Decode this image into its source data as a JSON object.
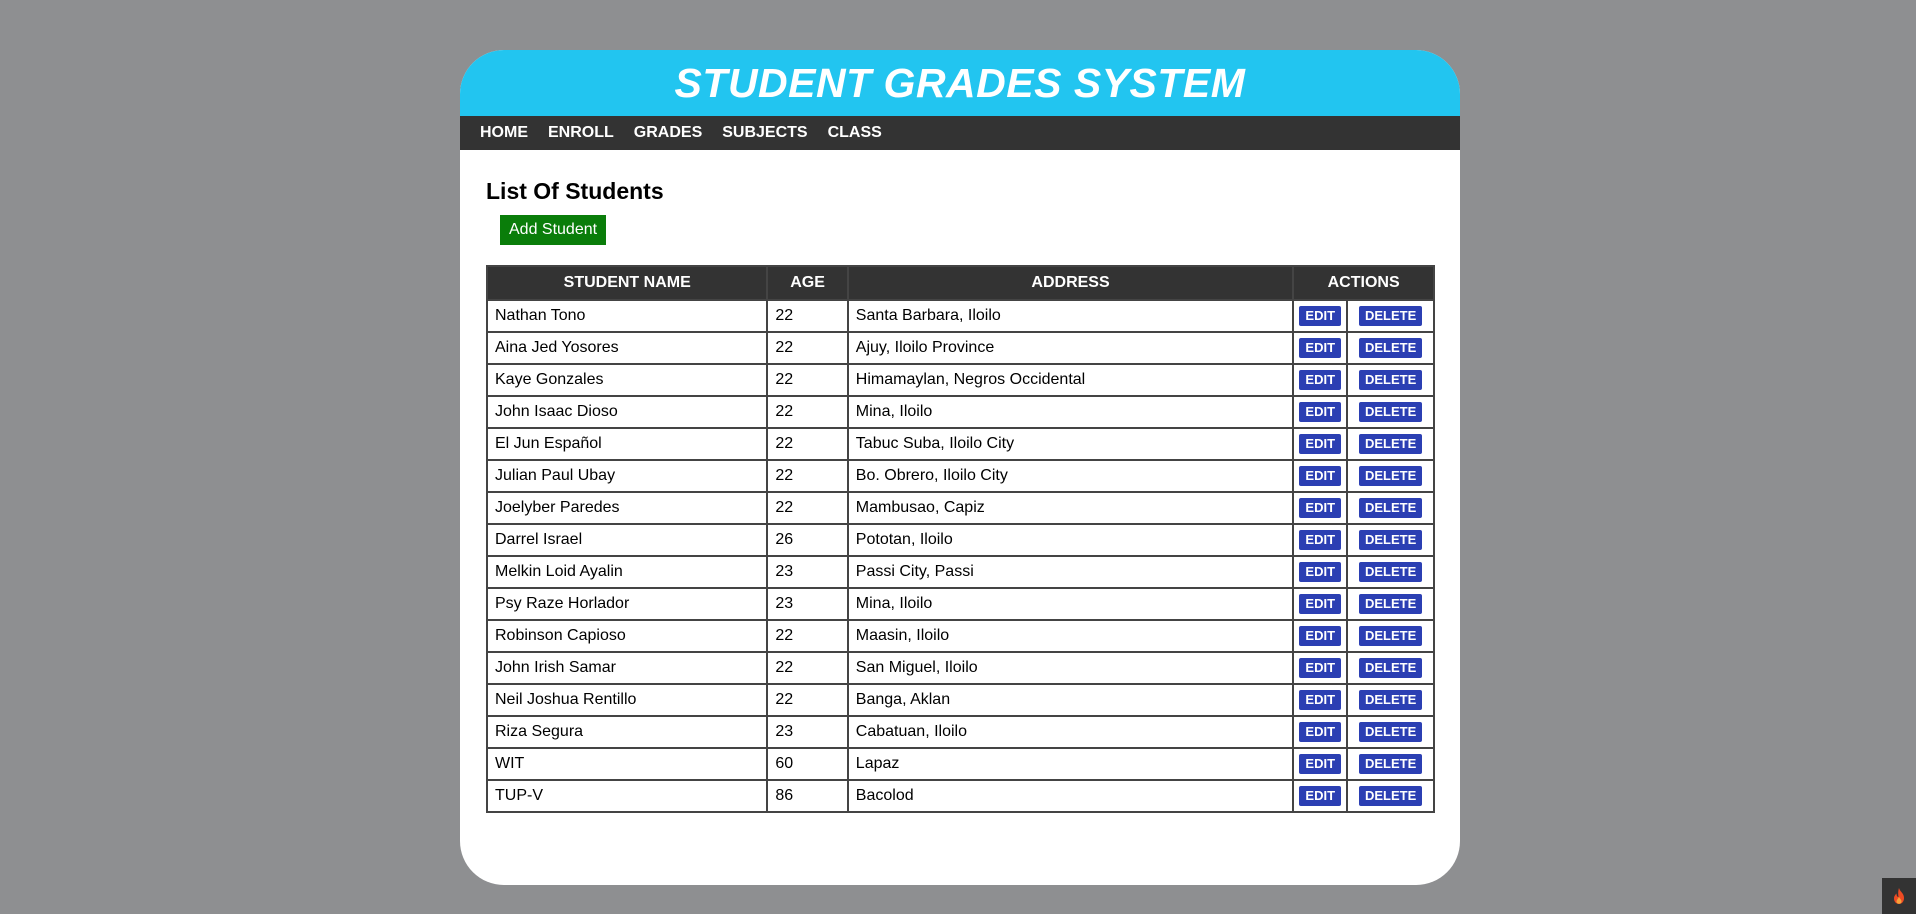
{
  "app": {
    "title": "STUDENT GRADES SYSTEM"
  },
  "nav": {
    "items": [
      {
        "label": "HOME"
      },
      {
        "label": "ENROLL"
      },
      {
        "label": "GRADES"
      },
      {
        "label": "SUBJECTS"
      },
      {
        "label": "CLASS"
      }
    ]
  },
  "main": {
    "title": "List Of Students",
    "add_button": "Add Student"
  },
  "table": {
    "headers": {
      "name": "STUDENT NAME",
      "age": "AGE",
      "address": "ADDRESS",
      "actions": "ACTIONS"
    },
    "edit_label": "EDIT",
    "delete_label": "DELETE",
    "rows": [
      {
        "name": "Nathan Tono",
        "age": "22",
        "address": "Santa Barbara, Iloilo"
      },
      {
        "name": "Aina Jed Yosores",
        "age": "22",
        "address": "Ajuy, Iloilo Province"
      },
      {
        "name": "Kaye Gonzales",
        "age": "22",
        "address": "Himamaylan, Negros Occidental"
      },
      {
        "name": "John Isaac Dioso",
        "age": "22",
        "address": "Mina, Iloilo"
      },
      {
        "name": "El Jun Español",
        "age": "22",
        "address": "Tabuc Suba, Iloilo City"
      },
      {
        "name": "Julian Paul Ubay",
        "age": "22",
        "address": "Bo. Obrero, Iloilo City"
      },
      {
        "name": "Joelyber Paredes",
        "age": "22",
        "address": "Mambusao, Capiz"
      },
      {
        "name": "Darrel Israel",
        "age": "26",
        "address": "Pototan, Iloilo"
      },
      {
        "name": "Melkin Loid Ayalin",
        "age": "23",
        "address": "Passi City, Passi"
      },
      {
        "name": "Psy Raze Horlador",
        "age": "23",
        "address": "Mina, Iloilo"
      },
      {
        "name": "Robinson Capioso",
        "age": "22",
        "address": "Maasin, Iloilo"
      },
      {
        "name": "John Irish Samar",
        "age": "22",
        "address": "San Miguel, Iloilo"
      },
      {
        "name": "Neil Joshua Rentillo",
        "age": "22",
        "address": "Banga, Aklan"
      },
      {
        "name": "Riza Segura",
        "age": "23",
        "address": "Cabatuan, Iloilo"
      },
      {
        "name": "WIT",
        "age": "60",
        "address": "Lapaz"
      },
      {
        "name": "TUP-V",
        "age": "86",
        "address": "Bacolod"
      }
    ]
  },
  "colors": {
    "page_bg": "#8e8f91",
    "header_bg": "#22c5f0",
    "nav_bg": "#333333",
    "add_button_bg": "#0a7d0a",
    "action_button_bg": "#2b3fb3"
  },
  "icons": {
    "corner": "flame-icon"
  }
}
